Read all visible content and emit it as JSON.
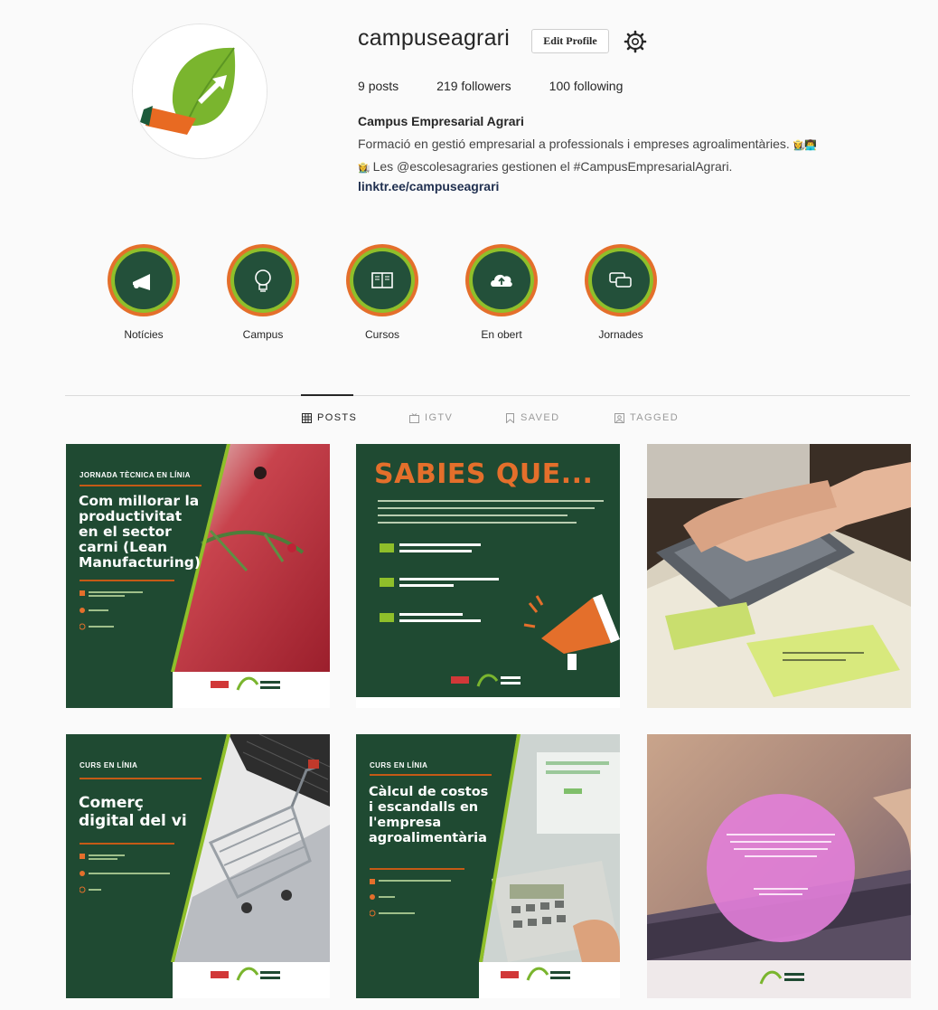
{
  "profile": {
    "username": "campuseagrari",
    "edit_label": "Edit Profile",
    "posts_count": "9",
    "posts_label": "posts",
    "followers_count": "219",
    "followers_label": "followers",
    "following_count": "100",
    "following_label": "following",
    "full_name": "Campus Empresarial Agrari",
    "bio_line1": "Formació en gestió empresarial a professionals i empreses agroalimentàries.",
    "bio_line2": "Les @escolesagraries gestionen el #CampusEmpresarialAgrari.",
    "link": "linktr.ee/campuseagrari"
  },
  "highlights": [
    {
      "label": "Notícies",
      "icon": "megaphone-icon"
    },
    {
      "label": "Campus",
      "icon": "lightbulb-icon"
    },
    {
      "label": "Cursos",
      "icon": "open-book-icon"
    },
    {
      "label": "En obert",
      "icon": "cloud-upload-icon"
    },
    {
      "label": "Jornades",
      "icon": "chat-bubbles-icon"
    }
  ],
  "tabs": [
    {
      "label": "POSTS",
      "icon": "grid-icon",
      "active": true
    },
    {
      "label": "IGTV",
      "icon": "tv-icon",
      "active": false
    },
    {
      "label": "SAVED",
      "icon": "bookmark-icon",
      "active": false
    },
    {
      "label": "TAGGED",
      "icon": "tag-icon",
      "active": false
    }
  ],
  "posts": {
    "p1": {
      "kicker": "JORNADA TÈCNICA EN LÍNIA",
      "headline": [
        "Com millorar la",
        "productivitat",
        "en el sector",
        "carni (Lean",
        "Manufacturing)"
      ]
    },
    "p2": {
      "headline": "SABIES QUE..."
    },
    "p4": {
      "kicker": "CURS EN LÍNIA",
      "headline": [
        "Comerç",
        "digital del vi"
      ]
    },
    "p5": {
      "kicker": "CURS EN LÍNIA",
      "headline": [
        "Càlcul de costos",
        "i escandalls en",
        "l'empresa",
        "agroalimentària"
      ]
    }
  },
  "colors": {
    "brand_green": "#1f4a32",
    "accent_orange": "#e46f2b",
    "accent_lime": "#8fbf2a"
  }
}
